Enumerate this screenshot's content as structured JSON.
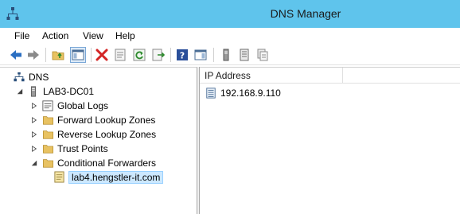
{
  "window": {
    "title": "DNS Manager"
  },
  "menu": [
    "File",
    "Action",
    "View",
    "Help"
  ],
  "toolbar": {
    "buttons": [
      "back-arrow-icon",
      "forward-arrow-icon",
      "up-folder-icon",
      "show-hide-console-tree-icon",
      "delete-icon",
      "properties-icon",
      "refresh-icon",
      "export-list-icon",
      "help-icon",
      "show-action-pane-icon",
      "server-icon",
      "zone-icon",
      "record-icon"
    ]
  },
  "tree": {
    "root": "DNS",
    "server": "LAB3-DC01",
    "children": [
      "Global Logs",
      "Forward Lookup Zones",
      "Reverse Lookup Zones",
      "Trust Points",
      "Conditional Forwarders"
    ],
    "forwarder": "lab4.hengstler-it.com"
  },
  "list": {
    "column": "IP Address",
    "rows": [
      "192.168.9.110"
    ]
  },
  "colors": {
    "titlebar": "#5fc4ec",
    "selection": "#cce8ff",
    "folder": "#e8c262",
    "accent": "#2b6fc2"
  }
}
